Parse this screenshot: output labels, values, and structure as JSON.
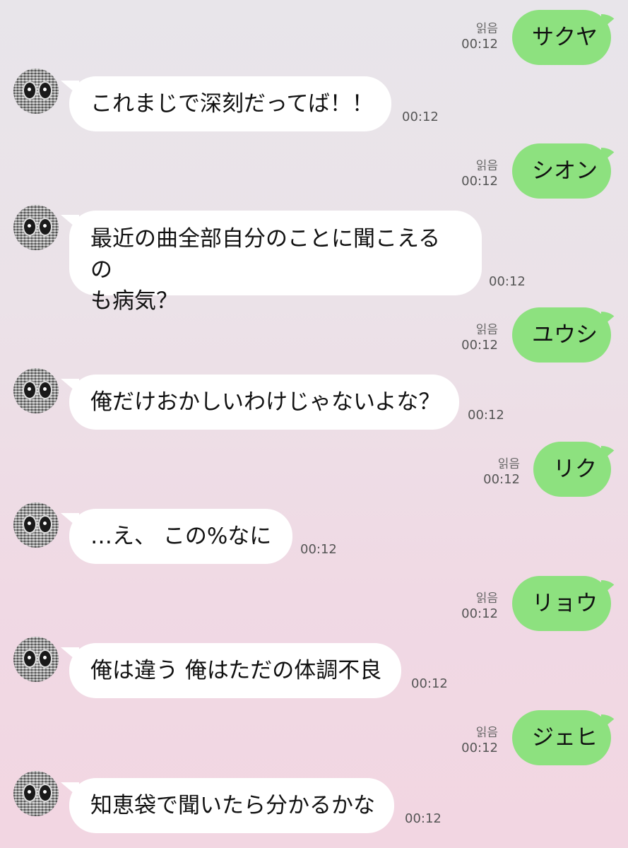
{
  "messages": [
    {
      "side": "out",
      "text": "サクヤ",
      "read": "읽음",
      "time": "00:12"
    },
    {
      "side": "in",
      "text": "これまじで深刻だってば！！",
      "time": "00:12"
    },
    {
      "side": "out",
      "text": "シオン",
      "read": "읽음",
      "time": "00:12"
    },
    {
      "side": "in",
      "text": "最近の曲全部自分のことに聞こえるのも病気？",
      "line1": "最近の曲全部自分のことに聞こえるの",
      "line2": "も病気？",
      "time": "00:12"
    },
    {
      "side": "out",
      "text": "ユウシ",
      "read": "읽음",
      "time": "00:12"
    },
    {
      "side": "in",
      "text": "俺だけおかしいわけじゃないよな？",
      "time": "00:12"
    },
    {
      "side": "out",
      "text": "リク",
      "read": "읽음",
      "time": "00:12"
    },
    {
      "side": "in",
      "text": "…え、 この%なに",
      "time": "00:12"
    },
    {
      "side": "out",
      "text": "リョウ",
      "read": "읽음",
      "time": "00:12"
    },
    {
      "side": "in",
      "text": "俺は違う 俺はただの体調不良",
      "time": "00:12"
    },
    {
      "side": "out",
      "text": "ジェヒ",
      "read": "읽음",
      "time": "00:12"
    },
    {
      "side": "in",
      "text": "知恵袋で聞いたら分かるかな",
      "time": "00:12"
    }
  ],
  "colors": {
    "outgoing_bubble": "#8de17f",
    "incoming_bubble": "#ffffff"
  },
  "icons": {
    "avatar": "pixelated-face-avatar"
  }
}
